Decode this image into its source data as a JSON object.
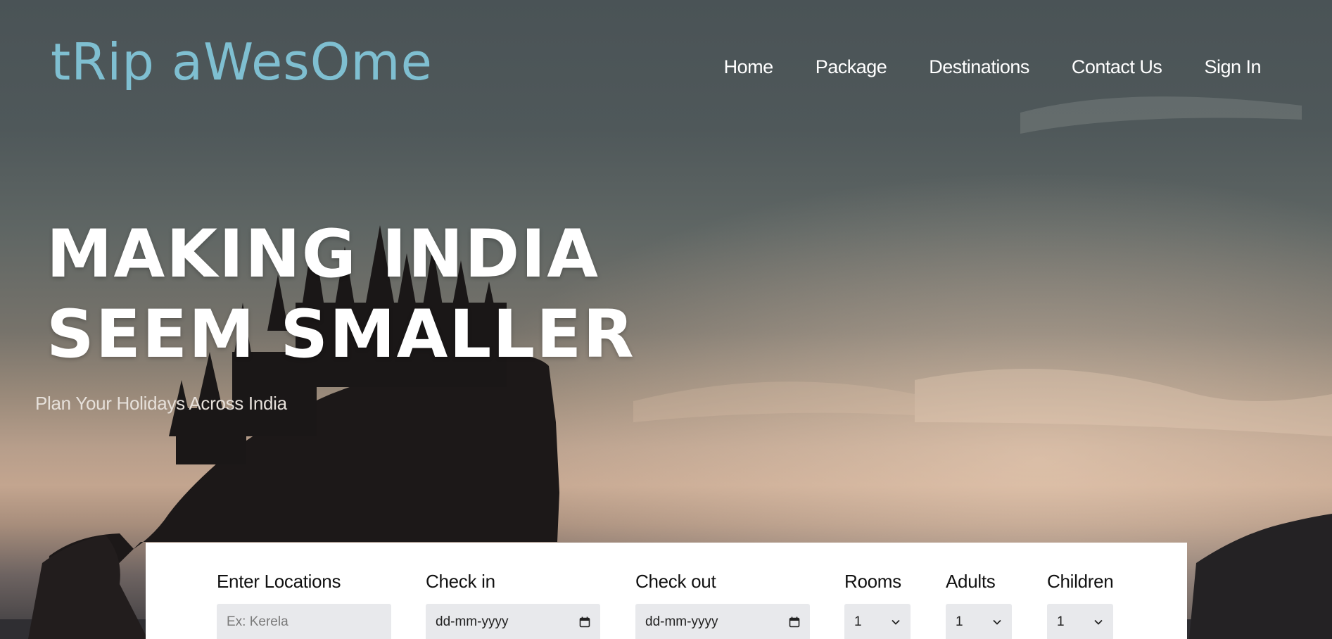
{
  "brand": {
    "logo": "tRip aWesOme"
  },
  "nav": {
    "items": [
      "Home",
      "Package",
      "Destinations",
      "Contact Us",
      "Sign In"
    ]
  },
  "hero": {
    "headline_line1": "MAKING INDIA",
    "headline_line2": "SEEM SMALLER",
    "tagline": "Plan Your Holidays Across India"
  },
  "search": {
    "location": {
      "label": "Enter Locations",
      "placeholder": "Ex: Kerela"
    },
    "checkin": {
      "label": "Check in",
      "value": "dd-mm-yyyy"
    },
    "checkout": {
      "label": "Check out",
      "value": "dd-mm-yyyy"
    },
    "rooms": {
      "label": "Rooms",
      "value": "1"
    },
    "adults": {
      "label": "Adults",
      "value": "1"
    },
    "children": {
      "label": "Children",
      "value": "1"
    }
  },
  "colors": {
    "logo": "#7fbfd1",
    "panel": "#ffffff",
    "input_bg": "#e8e9ec"
  },
  "icons": [
    "calendar-icon",
    "chevron-down-icon"
  ]
}
